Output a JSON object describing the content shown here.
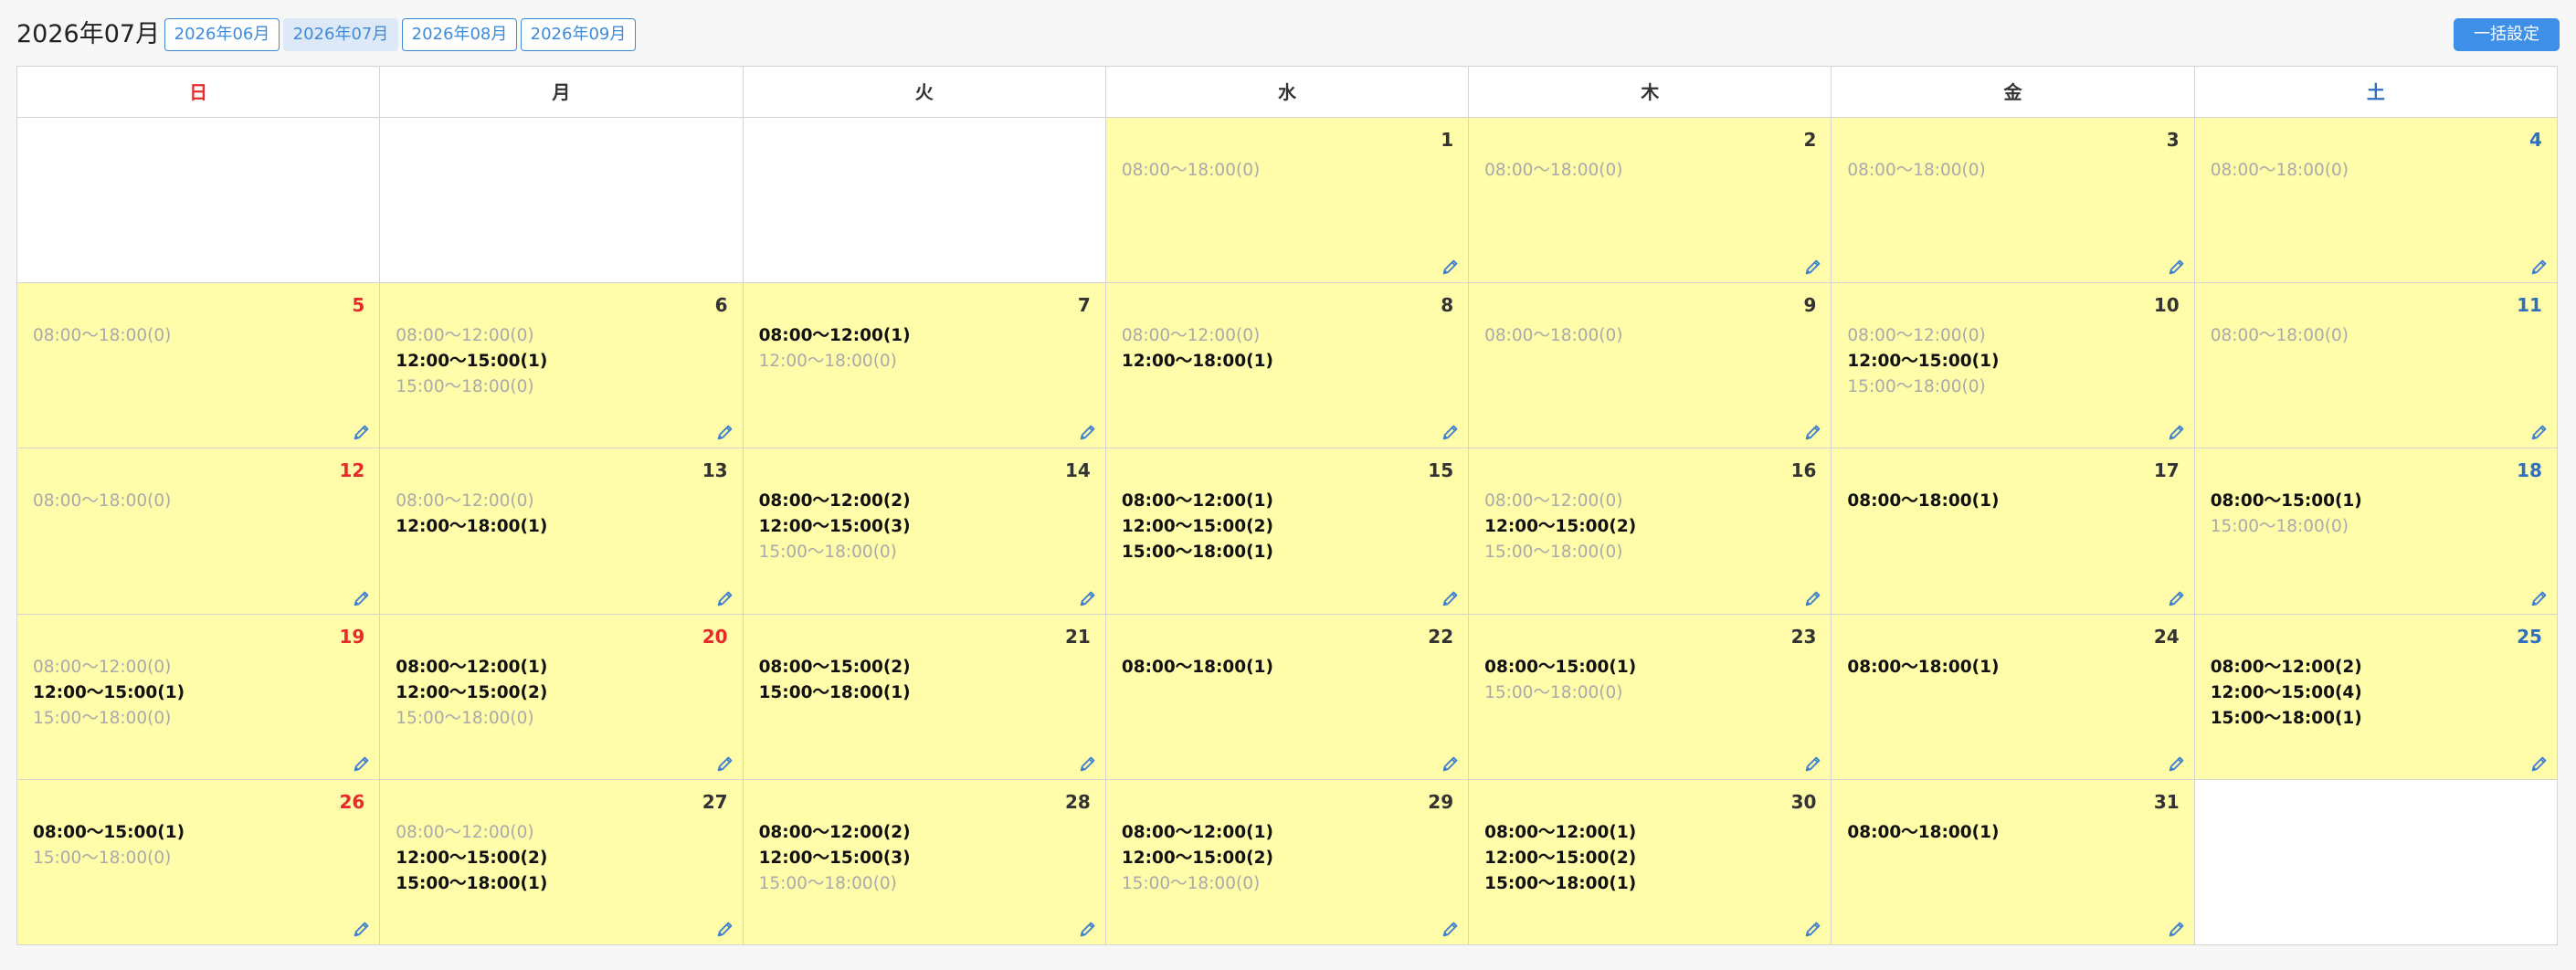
{
  "header": {
    "current_month": "2026年07月",
    "month_buttons": [
      {
        "label": "2026年06月",
        "active": false
      },
      {
        "label": "2026年07月",
        "active": true
      },
      {
        "label": "2026年08月",
        "active": false
      },
      {
        "label": "2026年09月",
        "active": false
      }
    ],
    "bulk_button": "一括設定"
  },
  "colors": {
    "sunday": "#e52b2b",
    "saturday": "#2f6fc0",
    "holiday": "#e52b2b",
    "cell_fill": "#fffcaa",
    "accent": "#3d8fe8",
    "inactive_text": "#aaaaaa"
  },
  "weekdays": [
    "日",
    "月",
    "火",
    "水",
    "木",
    "金",
    "土"
  ],
  "icons": {
    "edit": "pencil-icon"
  },
  "weeks": [
    [
      null,
      null,
      null,
      {
        "day": "1",
        "slots": [
          {
            "text": "08:00〜18:00(0)",
            "count": 0
          }
        ]
      },
      {
        "day": "2",
        "slots": [
          {
            "text": "08:00〜18:00(0)",
            "count": 0
          }
        ]
      },
      {
        "day": "3",
        "slots": [
          {
            "text": "08:00〜18:00(0)",
            "count": 0
          }
        ]
      },
      {
        "day": "4",
        "slots": [
          {
            "text": "08:00〜18:00(0)",
            "count": 0
          }
        ]
      }
    ],
    [
      {
        "day": "5",
        "slots": [
          {
            "text": "08:00〜18:00(0)",
            "count": 0
          }
        ]
      },
      {
        "day": "6",
        "slots": [
          {
            "text": "08:00〜12:00(0)",
            "count": 0
          },
          {
            "text": "12:00〜15:00(1)",
            "count": 1
          },
          {
            "text": "15:00〜18:00(0)",
            "count": 0
          }
        ]
      },
      {
        "day": "7",
        "slots": [
          {
            "text": "08:00〜12:00(1)",
            "count": 1
          },
          {
            "text": "12:00〜18:00(0)",
            "count": 0
          }
        ]
      },
      {
        "day": "8",
        "slots": [
          {
            "text": "08:00〜12:00(0)",
            "count": 0
          },
          {
            "text": "12:00〜18:00(1)",
            "count": 1
          }
        ]
      },
      {
        "day": "9",
        "slots": [
          {
            "text": "08:00〜18:00(0)",
            "count": 0
          }
        ]
      },
      {
        "day": "10",
        "slots": [
          {
            "text": "08:00〜12:00(0)",
            "count": 0
          },
          {
            "text": "12:00〜15:00(1)",
            "count": 1
          },
          {
            "text": "15:00〜18:00(0)",
            "count": 0
          }
        ]
      },
      {
        "day": "11",
        "slots": [
          {
            "text": "08:00〜18:00(0)",
            "count": 0
          }
        ]
      }
    ],
    [
      {
        "day": "12",
        "slots": [
          {
            "text": "08:00〜18:00(0)",
            "count": 0
          }
        ]
      },
      {
        "day": "13",
        "slots": [
          {
            "text": "08:00〜12:00(0)",
            "count": 0
          },
          {
            "text": "12:00〜18:00(1)",
            "count": 1
          }
        ]
      },
      {
        "day": "14",
        "slots": [
          {
            "text": "08:00〜12:00(2)",
            "count": 2
          },
          {
            "text": "12:00〜15:00(3)",
            "count": 3
          },
          {
            "text": "15:00〜18:00(0)",
            "count": 0
          }
        ]
      },
      {
        "day": "15",
        "slots": [
          {
            "text": "08:00〜12:00(1)",
            "count": 1
          },
          {
            "text": "12:00〜15:00(2)",
            "count": 2
          },
          {
            "text": "15:00〜18:00(1)",
            "count": 1
          }
        ]
      },
      {
        "day": "16",
        "slots": [
          {
            "text": "08:00〜12:00(0)",
            "count": 0
          },
          {
            "text": "12:00〜15:00(2)",
            "count": 2
          },
          {
            "text": "15:00〜18:00(0)",
            "count": 0
          }
        ]
      },
      {
        "day": "17",
        "slots": [
          {
            "text": "08:00〜18:00(1)",
            "count": 1
          }
        ]
      },
      {
        "day": "18",
        "slots": [
          {
            "text": "08:00〜15:00(1)",
            "count": 1
          },
          {
            "text": "15:00〜18:00(0)",
            "count": 0
          }
        ]
      }
    ],
    [
      {
        "day": "19",
        "slots": [
          {
            "text": "08:00〜12:00(0)",
            "count": 0
          },
          {
            "text": "12:00〜15:00(1)",
            "count": 1
          },
          {
            "text": "15:00〜18:00(0)",
            "count": 0
          }
        ]
      },
      {
        "day": "20",
        "holiday": true,
        "slots": [
          {
            "text": "08:00〜12:00(1)",
            "count": 1
          },
          {
            "text": "12:00〜15:00(2)",
            "count": 2
          },
          {
            "text": "15:00〜18:00(0)",
            "count": 0
          }
        ]
      },
      {
        "day": "21",
        "slots": [
          {
            "text": "08:00〜15:00(2)",
            "count": 2
          },
          {
            "text": "15:00〜18:00(1)",
            "count": 1
          }
        ]
      },
      {
        "day": "22",
        "slots": [
          {
            "text": "08:00〜18:00(1)",
            "count": 1
          }
        ]
      },
      {
        "day": "23",
        "slots": [
          {
            "text": "08:00〜15:00(1)",
            "count": 1
          },
          {
            "text": "15:00〜18:00(0)",
            "count": 0
          }
        ]
      },
      {
        "day": "24",
        "slots": [
          {
            "text": "08:00〜18:00(1)",
            "count": 1
          }
        ]
      },
      {
        "day": "25",
        "slots": [
          {
            "text": "08:00〜12:00(2)",
            "count": 2
          },
          {
            "text": "12:00〜15:00(4)",
            "count": 4
          },
          {
            "text": "15:00〜18:00(1)",
            "count": 1
          }
        ]
      }
    ],
    [
      {
        "day": "26",
        "slots": [
          {
            "text": "08:00〜15:00(1)",
            "count": 1
          },
          {
            "text": "15:00〜18:00(0)",
            "count": 0
          }
        ]
      },
      {
        "day": "27",
        "slots": [
          {
            "text": "08:00〜12:00(0)",
            "count": 0
          },
          {
            "text": "12:00〜15:00(2)",
            "count": 2
          },
          {
            "text": "15:00〜18:00(1)",
            "count": 1
          }
        ]
      },
      {
        "day": "28",
        "slots": [
          {
            "text": "08:00〜12:00(2)",
            "count": 2
          },
          {
            "text": "12:00〜15:00(3)",
            "count": 3
          },
          {
            "text": "15:00〜18:00(0)",
            "count": 0
          }
        ]
      },
      {
        "day": "29",
        "slots": [
          {
            "text": "08:00〜12:00(1)",
            "count": 1
          },
          {
            "text": "12:00〜15:00(2)",
            "count": 2
          },
          {
            "text": "15:00〜18:00(0)",
            "count": 0
          }
        ]
      },
      {
        "day": "30",
        "slots": [
          {
            "text": "08:00〜12:00(1)",
            "count": 1
          },
          {
            "text": "12:00〜15:00(2)",
            "count": 2
          },
          {
            "text": "15:00〜18:00(1)",
            "count": 1
          }
        ]
      },
      {
        "day": "31",
        "slots": [
          {
            "text": "08:00〜18:00(1)",
            "count": 1
          }
        ]
      },
      null
    ]
  ]
}
